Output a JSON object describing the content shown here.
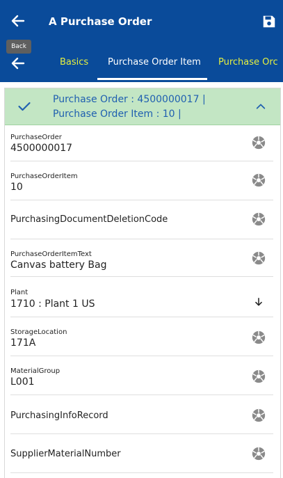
{
  "app_bar": {
    "title": "A Purchase Order",
    "back_icon": "arrow-left-icon",
    "save_icon": "save-icon"
  },
  "tooltip": {
    "text": "Back"
  },
  "tabs": {
    "back_icon": "arrow-left-icon",
    "items": [
      {
        "label": "Basics",
        "active": false
      },
      {
        "label": "Purchase Order Item",
        "active": true
      },
      {
        "label": "Purchase Orc",
        "active": false
      }
    ],
    "inactive_color": "#e6f040",
    "active_color": "#ffffff"
  },
  "section": {
    "line1": "Purchase Order : 4500000017 |",
    "line2": "Purchase Order Item : 10 |",
    "header_bg": "#c3e6c4",
    "text_color": "#1f5fb0"
  },
  "fields": [
    {
      "label": "PurchaseOrder",
      "value": "4500000017",
      "icon": "value-help-icon"
    },
    {
      "label": "PurchaseOrderItem",
      "value": "10",
      "icon": "value-help-icon"
    },
    {
      "label": "PurchasingDocumentDeletionCode",
      "value": "",
      "icon": "value-help-icon"
    },
    {
      "label": "PurchaseOrderItemText",
      "value": "Canvas battery Bag",
      "icon": "value-help-icon"
    },
    {
      "label": "Plant",
      "value": "1710 : Plant 1 US",
      "icon": "arrow-down-icon"
    },
    {
      "label": "StorageLocation",
      "value": "171A",
      "icon": "value-help-icon"
    },
    {
      "label": "MaterialGroup",
      "value": "L001",
      "icon": "value-help-icon"
    },
    {
      "label": "PurchasingInfoRecord",
      "value": "",
      "icon": "value-help-icon"
    },
    {
      "label": "SupplierMaterialNumber",
      "value": "",
      "icon": "value-help-icon"
    }
  ],
  "colors": {
    "primary": "#0a4b9a"
  }
}
